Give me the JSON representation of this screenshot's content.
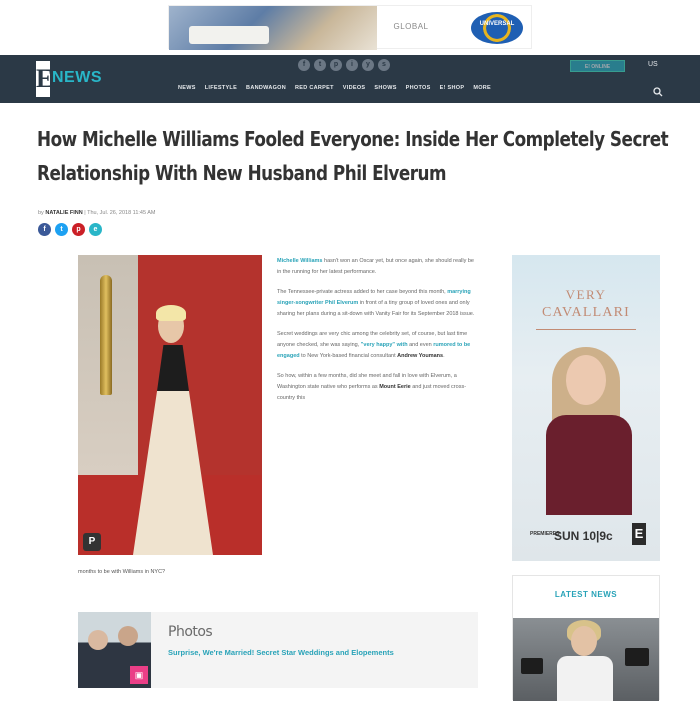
{
  "top_ad": {
    "text": "GLOBAL",
    "logo_text": "UNIVERSAL"
  },
  "header": {
    "logo_e": "E",
    "logo_news": "NEWS",
    "social": [
      "f",
      "t",
      "p",
      "i",
      "y",
      "s"
    ],
    "nav": [
      "NEWS",
      "LIFESTYLE",
      "BANDWAGON",
      "RED CARPET",
      "VIDEOS",
      "SHOWS",
      "PHOTOS",
      "E! SHOP",
      "MORE"
    ],
    "tv_button": "E! ONLINE",
    "region": "US"
  },
  "article": {
    "headline": "How Michelle Williams Fooled Everyone: Inside Her Completely Secret Relationship With New Husband Phil Elverum",
    "byline_prefix": "by",
    "author": "NATALIE FINN",
    "date": "| Thu, Jul. 26, 2018 11:45 AM",
    "share": [
      "f",
      "t",
      "p",
      "e"
    ],
    "image_caption": "months to be with Williams in NYC?",
    "pin_label": "P",
    "paragraphs": [
      {
        "link": "Michelle Williams",
        "text": " hasn't won an Oscar yet, but once again, she should really be in the running for her latest performance."
      },
      {
        "text_before": "The Tennessee-private actress added to her case beyond this month, ",
        "link": "marrying singer-songwriter Phil Elverum",
        "text_after": " in front of a tiny group of loved ones and only sharing her plans during a sit-down with Vanity Fair for its September 2018 issue."
      },
      {
        "text_before": "Secret weddings are very chic among the celebrity set, of course, but last time anyone checked, she was saying, ",
        "link": "\"very happy\" with",
        "text_mid": " and even ",
        "link2": "rumored to be engaged",
        "text_after": " to New York-based financial consultant ",
        "bold": "Andrew Youmans",
        "end": "."
      },
      {
        "text_before": "So how, within a few months, did she meet and fall in love with Elverum, a Washington state native who performs as ",
        "bold": "Mount Eerie",
        "text_after": " and just moved cross-country this"
      }
    ]
  },
  "photos": {
    "label": "Photos",
    "title": "Surprise, We're Married! Secret Star Weddings and Elopements"
  },
  "right_ad": {
    "line1": "VERY",
    "line2": "CAVALLARI",
    "premier": "PREMIERES",
    "time": "SUN 10|9c",
    "logo": "E"
  },
  "latest_news": {
    "title": "LATEST NEWS"
  }
}
